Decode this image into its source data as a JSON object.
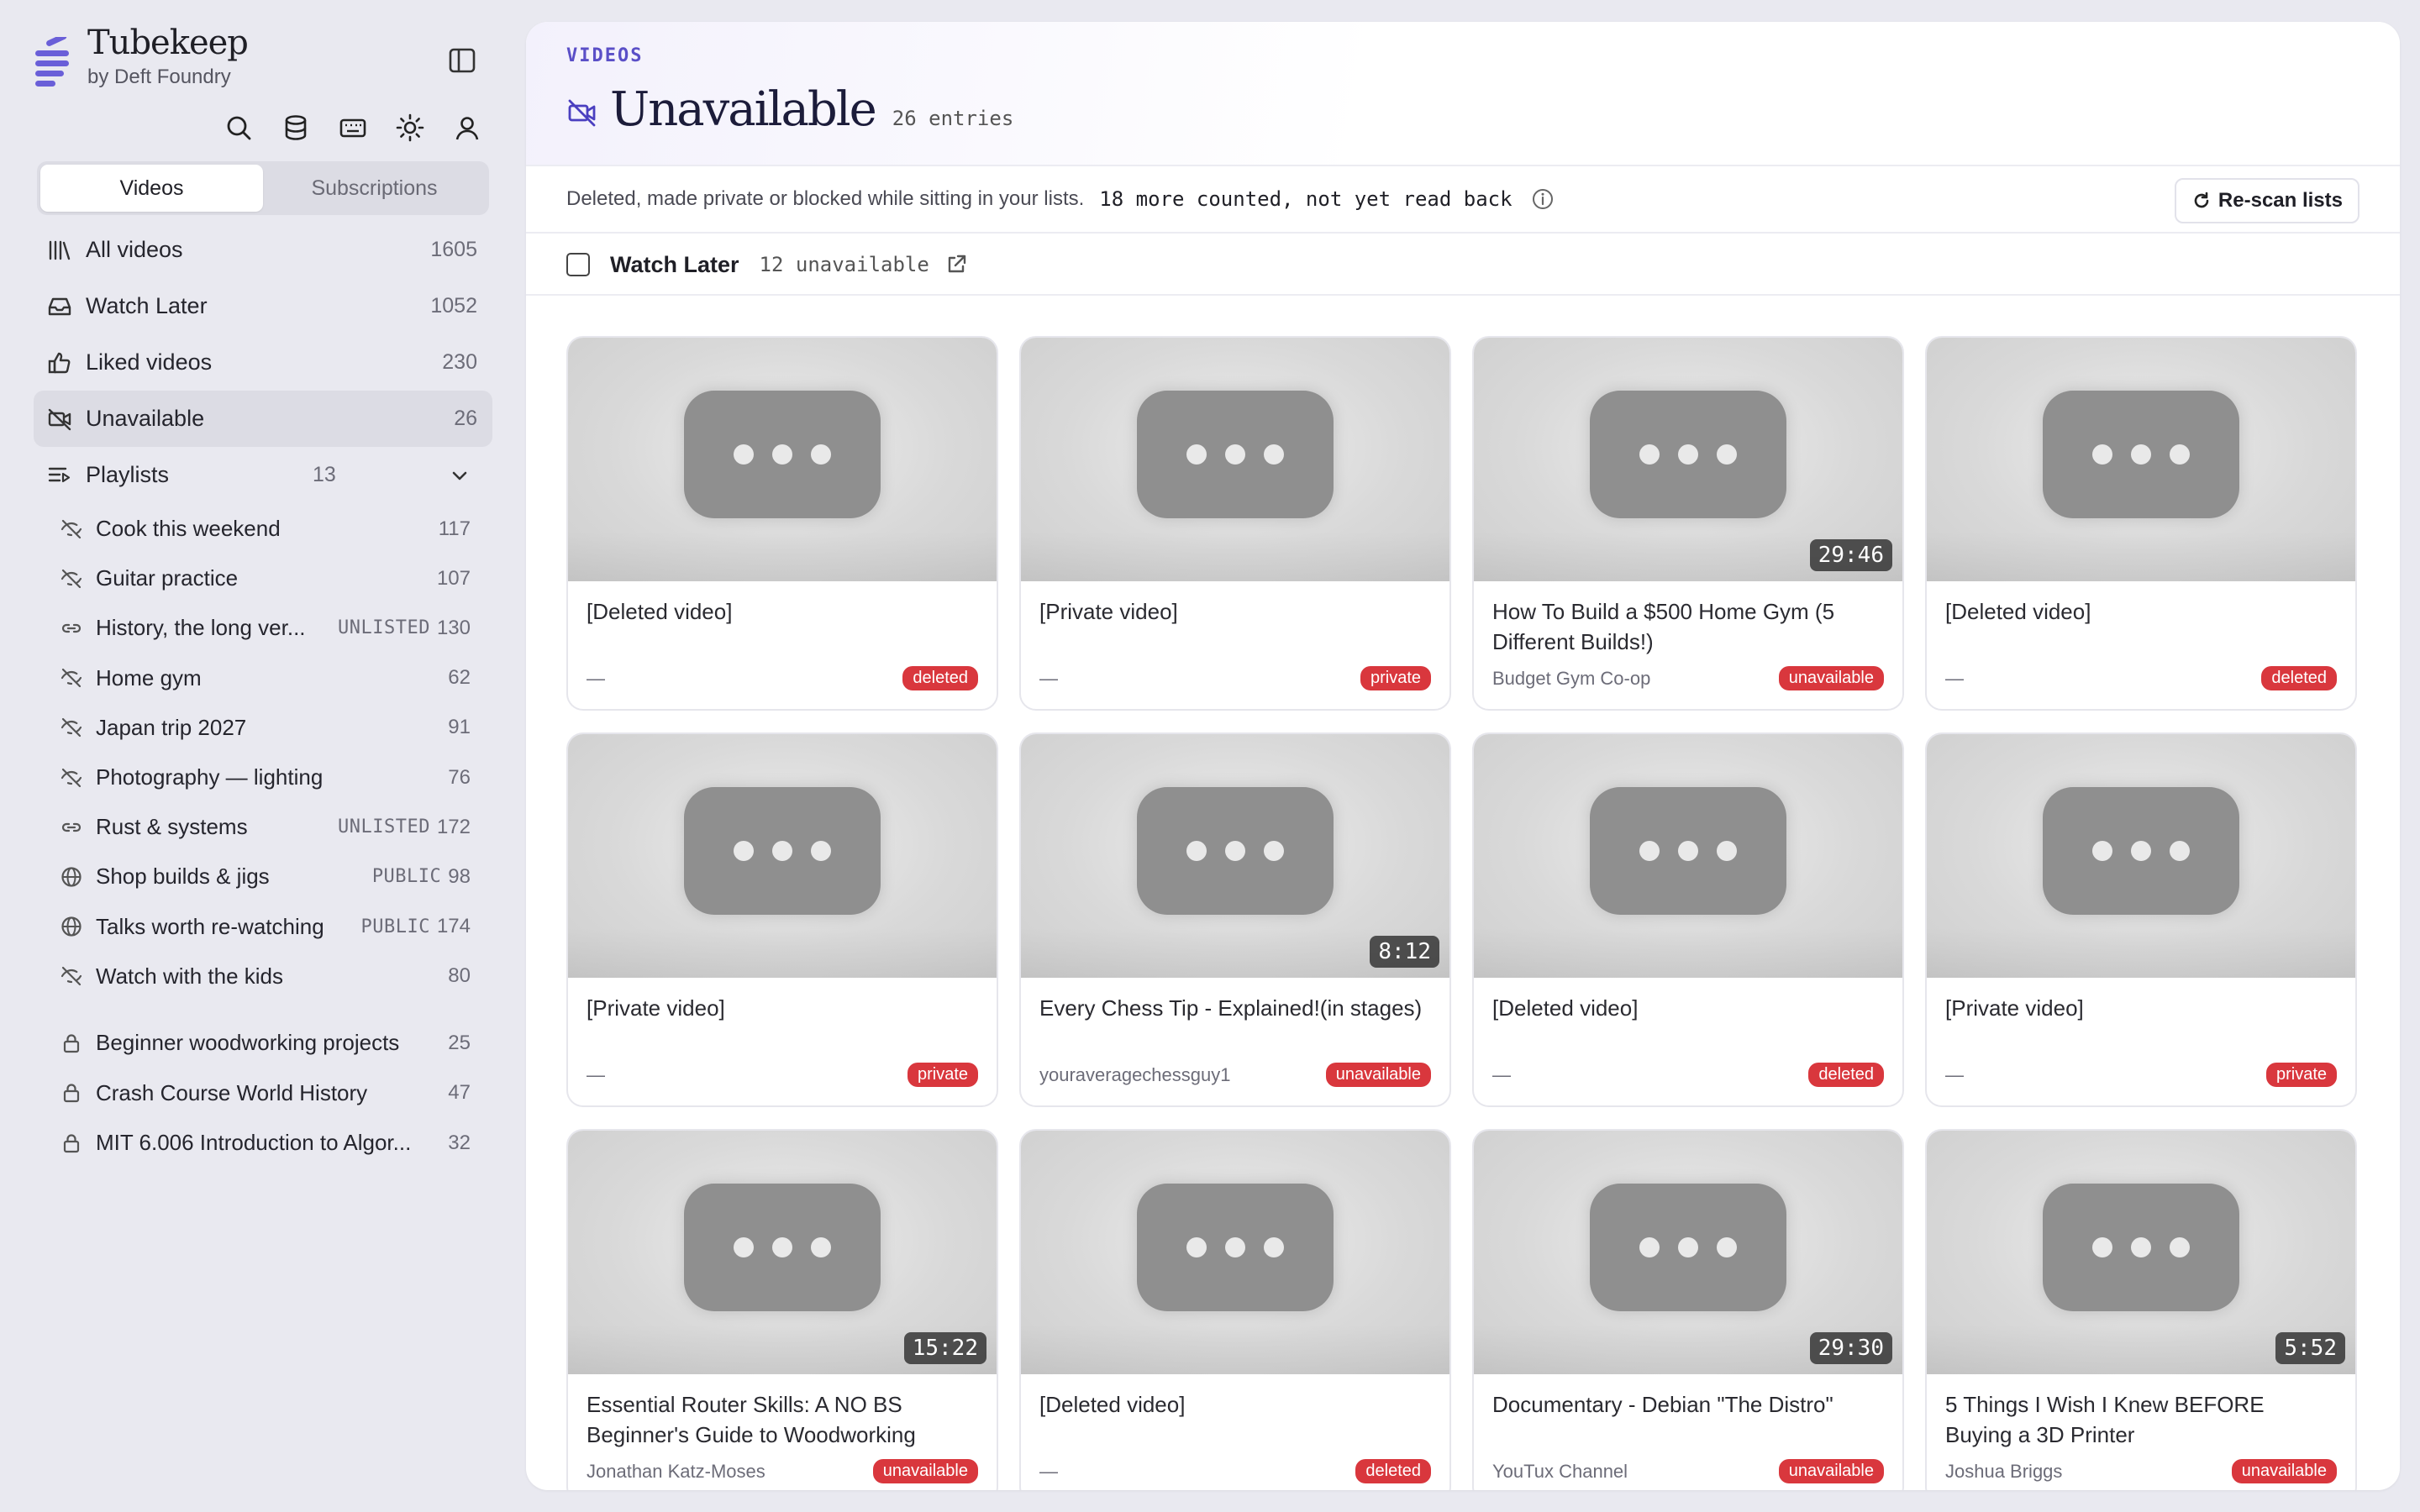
{
  "brand": {
    "name": "Tubekeep",
    "by": "by Deft Foundry"
  },
  "segments": [
    "Videos",
    "Subscriptions"
  ],
  "nav": [
    {
      "label": "All videos",
      "count": "1605",
      "icon": "library-icon"
    },
    {
      "label": "Watch Later",
      "count": "1052",
      "icon": "inbox-icon"
    },
    {
      "label": "Liked videos",
      "count": "230",
      "icon": "thumb-up-icon"
    },
    {
      "label": "Unavailable",
      "count": "26",
      "icon": "video-off-icon"
    },
    {
      "label": "Playlists",
      "count": "13",
      "icon": "playlist-icon"
    }
  ],
  "playlists": [
    {
      "label": "Cook this weekend",
      "visibility": "",
      "count": "117",
      "icon": "eye-off-icon"
    },
    {
      "label": "Guitar practice",
      "visibility": "",
      "count": "107",
      "icon": "eye-off-icon"
    },
    {
      "label": "History, the long ver...",
      "visibility": "UNLISTED",
      "count": "130",
      "icon": "link-icon"
    },
    {
      "label": "Home gym",
      "visibility": "",
      "count": "62",
      "icon": "eye-off-icon"
    },
    {
      "label": "Japan trip 2027",
      "visibility": "",
      "count": "91",
      "icon": "eye-off-icon"
    },
    {
      "label": "Photography — lighting",
      "visibility": "",
      "count": "76",
      "icon": "eye-off-icon"
    },
    {
      "label": "Rust & systems",
      "visibility": "UNLISTED",
      "count": "172",
      "icon": "link-icon"
    },
    {
      "label": "Shop builds & jigs",
      "visibility": "PUBLIC",
      "count": "98",
      "icon": "globe-icon"
    },
    {
      "label": "Talks worth re-watching",
      "visibility": "PUBLIC",
      "count": "174",
      "icon": "globe-icon"
    },
    {
      "label": "Watch with the kids",
      "visibility": "",
      "count": "80",
      "icon": "eye-off-icon"
    }
  ],
  "locked_playlists": [
    {
      "label": "Beginner woodworking projects",
      "count": "25",
      "icon": "lock-icon"
    },
    {
      "label": "Crash Course World History",
      "count": "47",
      "icon": "lock-icon"
    },
    {
      "label": "MIT 6.006 Introduction to Algor...",
      "count": "32",
      "icon": "lock-icon"
    }
  ],
  "header": {
    "eyebrow": "VIDEOS",
    "title": "Unavailable",
    "entries": "26 entries",
    "description": "Deleted, made private or blocked while sitting in your lists.",
    "note": "18 more counted, not yet read back",
    "rescan": "Re-scan lists"
  },
  "watch_later": {
    "name": "Watch Later",
    "count": "12 unavailable"
  },
  "cards": [
    {
      "title": "[Deleted video]",
      "channel": "—",
      "status": "deleted",
      "duration": ""
    },
    {
      "title": "[Private video]",
      "channel": "—",
      "status": "private",
      "duration": ""
    },
    {
      "title": "How To Build a $500 Home Gym (5 Different Builds!)",
      "channel": "Budget Gym Co-op",
      "status": "unavailable",
      "duration": "29:46"
    },
    {
      "title": "[Deleted video]",
      "channel": "—",
      "status": "deleted",
      "duration": ""
    },
    {
      "title": "[Private video]",
      "channel": "—",
      "status": "private",
      "duration": ""
    },
    {
      "title": "Every Chess Tip - Explained!(in stages)",
      "channel": "youraveragechessguy1",
      "status": "unavailable",
      "duration": "8:12"
    },
    {
      "title": "[Deleted video]",
      "channel": "—",
      "status": "deleted",
      "duration": ""
    },
    {
      "title": "[Private video]",
      "channel": "—",
      "status": "private",
      "duration": ""
    },
    {
      "title": "Essential Router Skills: A NO BS Beginner's Guide to Woodworking",
      "channel": "Jonathan Katz-Moses",
      "status": "unavailable",
      "duration": "15:22"
    },
    {
      "title": "[Deleted video]",
      "channel": "—",
      "status": "deleted",
      "duration": ""
    },
    {
      "title": "Documentary - Debian \"The Distro\"",
      "channel": "YouTux Channel",
      "status": "unavailable",
      "duration": "29:30"
    },
    {
      "title": "5 Things I Wish I Knew BEFORE Buying a 3D Printer",
      "channel": "Joshua Briggs",
      "status": "unavailable",
      "duration": "5:52"
    }
  ],
  "colors": {
    "accent": "#5a4fc7",
    "badge": "#d9373d",
    "sidebar_bg": "#e9e9f0"
  }
}
